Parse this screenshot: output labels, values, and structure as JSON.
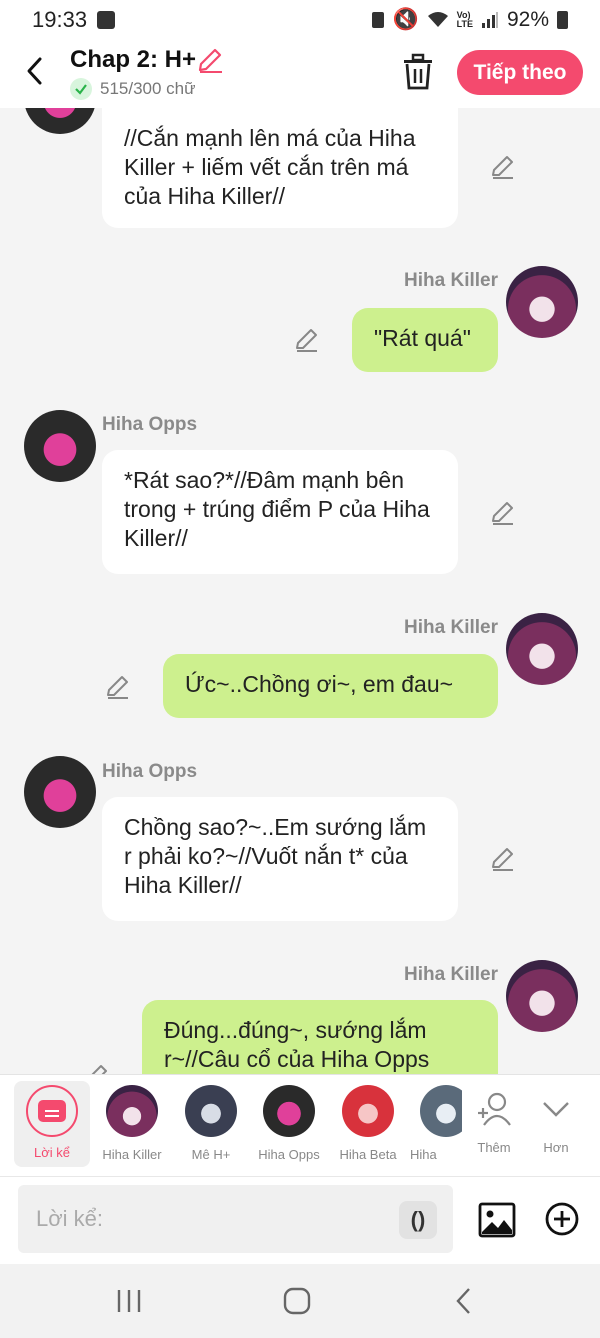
{
  "status": {
    "time": "19:33",
    "battery": "92%"
  },
  "header": {
    "title": "Chap 2: H+",
    "word_count": "515/300 chữ",
    "next_label": "Tiếp theo",
    "accent": "#f44a6e"
  },
  "messages": [
    {
      "speaker": "",
      "side": "left",
      "text": "//Cắn mạnh lên má của Hiha Killer + liếm vết cắn trên má của Hiha Killer//"
    },
    {
      "speaker": "Hiha Killer",
      "side": "right",
      "text": "\"Rát quá\""
    },
    {
      "speaker": "Hiha Opps",
      "side": "left",
      "text": "*Rát sao?*//Đâm mạnh bên trong + trúng điểm P của Hiha Killer//"
    },
    {
      "speaker": "Hiha Killer",
      "side": "right",
      "text": "Ức~..Chồng ơi~, em đau~"
    },
    {
      "speaker": "Hiha Opps",
      "side": "left",
      "text": "Chồng sao?~..Em sướng lắm r phải ko?~//Vuốt nắn t* của Hiha Killer//"
    },
    {
      "speaker": "Hiha Killer",
      "side": "right",
      "text": "Đúng...đúng~, sướng lắm r~//Câu cổ của Hiha Opps"
    }
  ],
  "characters": {
    "narrator": "Lời kể",
    "list": [
      "Hiha Killer",
      "Mê H+",
      "Hiha Opps",
      "Hiha Beta",
      "Hiha"
    ],
    "add_label": "Thêm",
    "more_label": "Hơn"
  },
  "input": {
    "placeholder": "Lời kể:",
    "paren": "()"
  }
}
